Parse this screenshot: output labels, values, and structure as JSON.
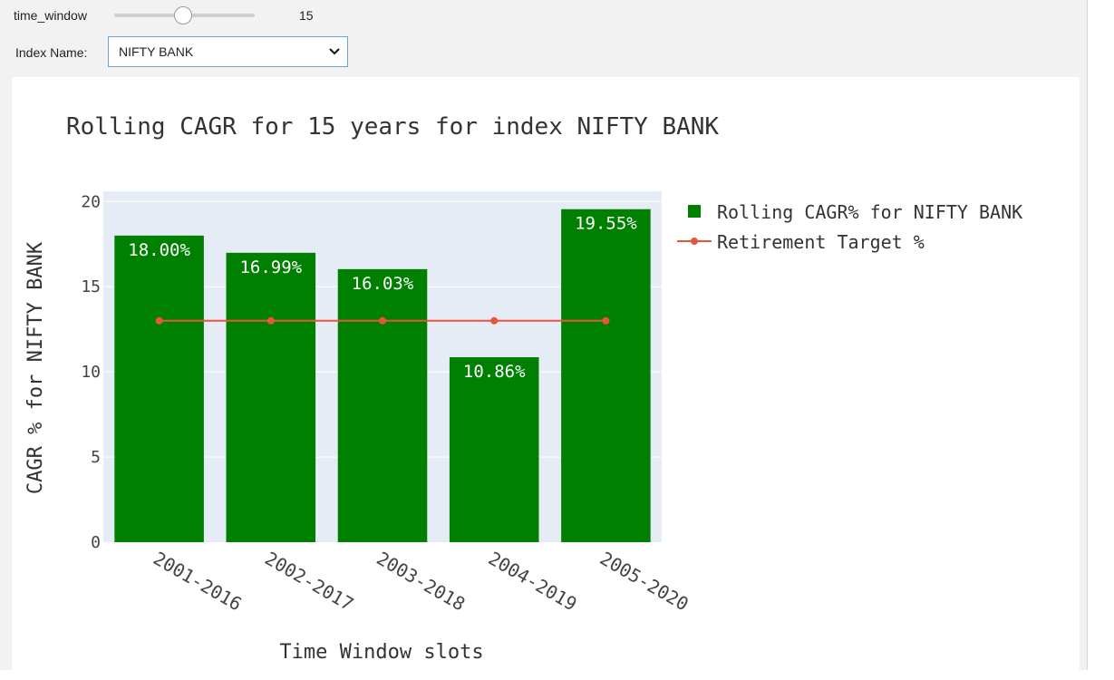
{
  "controls": {
    "slider": {
      "label": "time_window",
      "value": "15",
      "min": 1,
      "max": 20
    },
    "select": {
      "label": "Index Name:",
      "value": "NIFTY BANK"
    }
  },
  "chart_data": {
    "type": "bar",
    "title": "Rolling CAGR for 15 years for index NIFTY BANK",
    "xlabel": "Time Window slots",
    "ylabel": "CAGR % for NIFTY BANK",
    "categories": [
      "2001-2016",
      "2002-2017",
      "2003-2018",
      "2004-2019",
      "2005-2020"
    ],
    "ylim": [
      0,
      20.6
    ],
    "yticks": [
      0,
      5,
      10,
      15,
      20
    ],
    "grid": true,
    "legend_position": "top-right",
    "series": [
      {
        "name": "Rolling CAGR% for NIFTY BANK",
        "type": "bar",
        "values": [
          18.0,
          16.99,
          16.03,
          10.86,
          19.55
        ],
        "labels": [
          "18.00%",
          "16.99%",
          "16.03%",
          "10.86%",
          "19.55%"
        ],
        "color": "#008000"
      },
      {
        "name": "Retirement Target %",
        "type": "line",
        "values": [
          13,
          13,
          13,
          13,
          13
        ],
        "color": "#e8553d"
      }
    ],
    "plot_background": "#e5ecf6"
  }
}
